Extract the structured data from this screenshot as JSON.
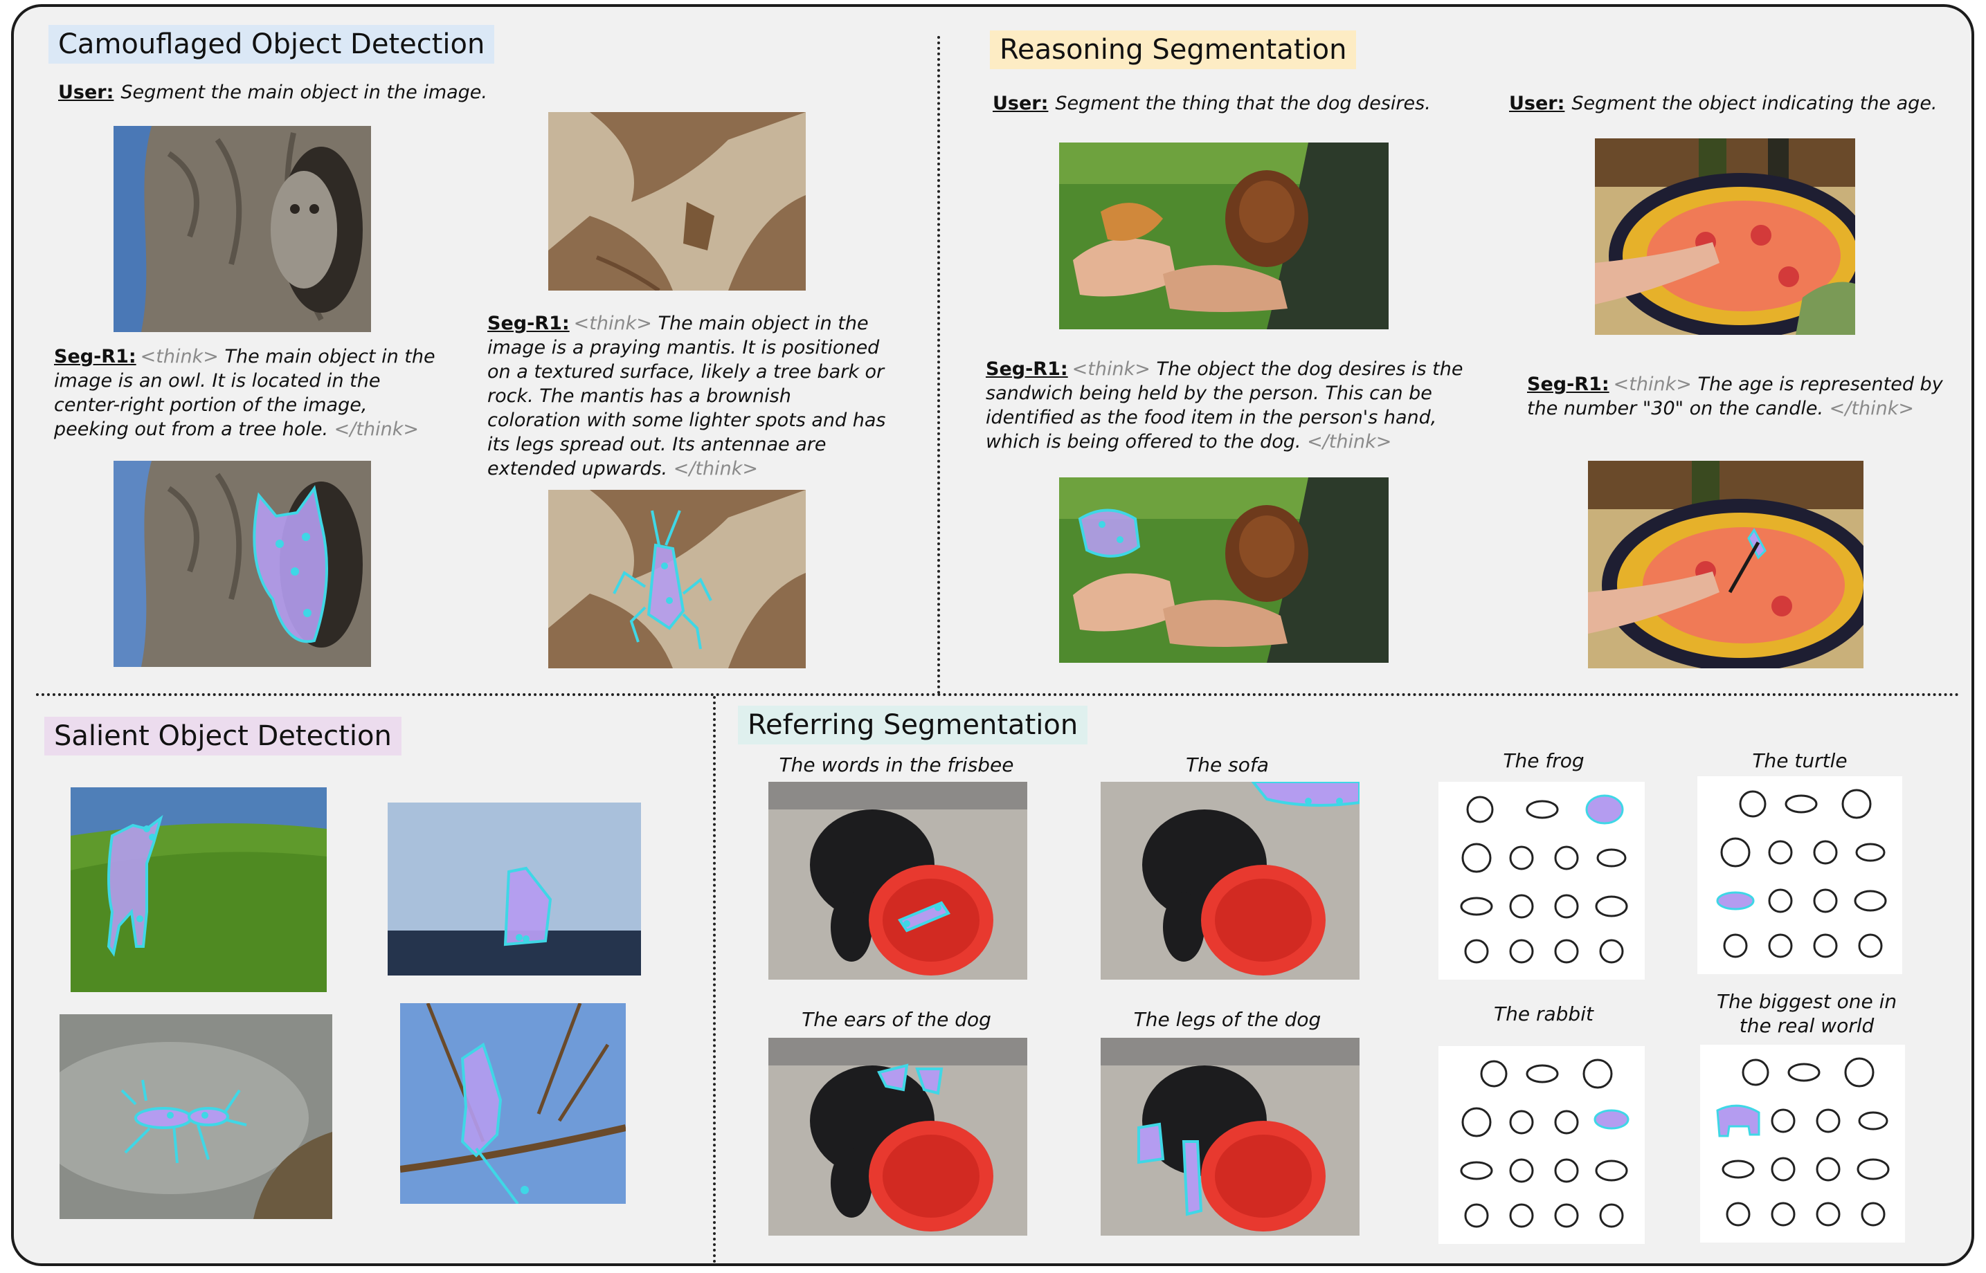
{
  "sections": {
    "camouflaged": {
      "title": "Camouflaged Object Detection",
      "title_bg": "#dbe8f6",
      "user_label": "User:",
      "prompt": "Segment the main object in the image.",
      "examples": [
        {
          "seg_label": "Seg-R1:",
          "think_open": "<think>",
          "text": " The main object in the image is an owl. It is located in the center-right portion of the image, peeking out from a tree hole. ",
          "think_close": "</think>"
        },
        {
          "seg_label": "Seg-R1:",
          "think_open": "<think>",
          "text": " The main object in the image is a praying mantis. It is positioned on a textured surface, likely a tree bark or rock. The mantis has a brownish coloration with some lighter spots and has its legs spread out. Its antennae are extended upwards. ",
          "think_close": "</think>"
        }
      ]
    },
    "reasoning": {
      "title": "Reasoning Segmentation",
      "title_bg": "#fdecc4",
      "examples": [
        {
          "user_label": "User:",
          "prompt": "Segment the thing that the dog desires.",
          "seg_label": "Seg-R1:",
          "think_open": "<think>",
          "text": " The object the dog desires is the sandwich being held by the person. This can be identified as the food item in the person's hand, which is being offered to the dog. ",
          "think_close": "</think>"
        },
        {
          "user_label": "User:",
          "prompt": "Segment the object indicating the age.",
          "seg_label": "Seg-R1:",
          "think_open": "<think>",
          "text": " The age is represented by the number \"30\" on the candle. ",
          "think_close": "</think>"
        }
      ]
    },
    "salient": {
      "title": "Salient Object Detection",
      "title_bg": "#ecdcee"
    },
    "referring": {
      "title": "Referring Segmentation",
      "title_bg": "#dff0ee",
      "captions": [
        "The words in the frisbee",
        "The sofa",
        "The ears of the dog",
        "The legs of the dog",
        "The frog",
        "The turtle",
        "The rabbit",
        "The biggest one in the real world"
      ]
    }
  },
  "colors": {
    "mask_fill": "#b49cf0",
    "contour": "#3fd7e6",
    "frisbee": "#e8392f",
    "grass": "#5f9a2c"
  }
}
